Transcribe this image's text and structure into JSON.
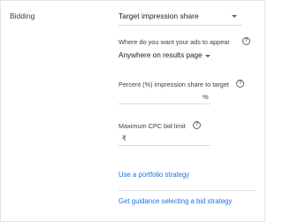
{
  "bidding": {
    "section_label": "Bidding",
    "strategy_value": "Target impression share",
    "location_question": "Where do you want your ads to appear",
    "location_value": "Anywhere on results page",
    "percent_label": "Percent (%) impression share to target",
    "percent_value": "",
    "percent_suffix": "%",
    "max_cpc_label": "Maximum CPC bid limit",
    "max_cpc_value": "",
    "currency_symbol": "₹",
    "help_glyph": "?",
    "portfolio_link": "Use a portfolio strategy",
    "guidance_link": "Get guidance selecting a bid strategy"
  },
  "colors": {
    "link": "#1a73e8",
    "text": "#3c4043",
    "underline": "#dadce0"
  },
  "icons": [
    "dropdown-arrow-icon",
    "help-icon"
  ]
}
